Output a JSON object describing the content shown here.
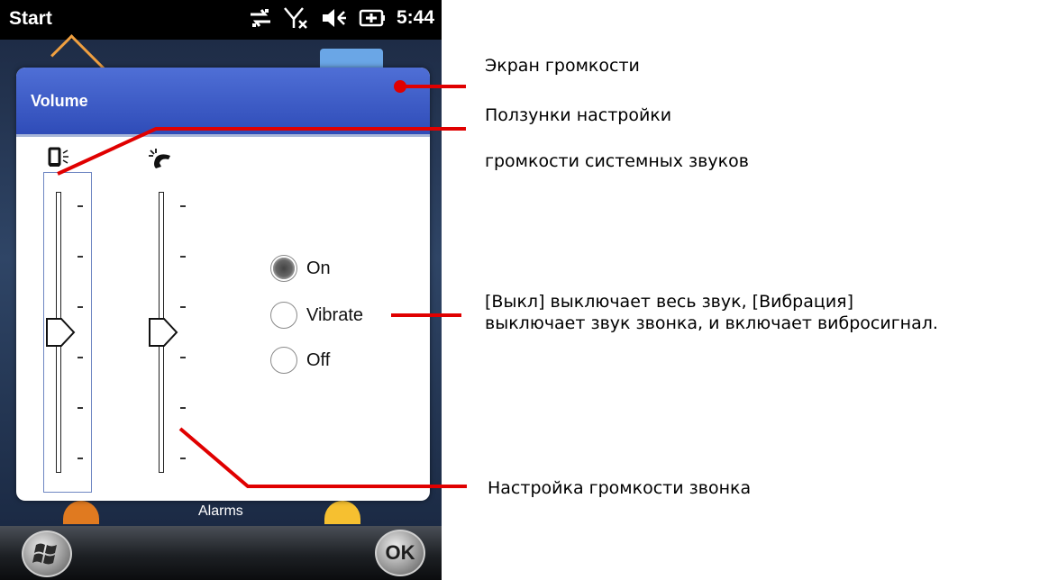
{
  "status_bar": {
    "start_label": "Start",
    "time": "5:44"
  },
  "home": {
    "alarms_label": "Alarms"
  },
  "dialog": {
    "title": "Volume",
    "device_volume_level": 0.5,
    "ringer_volume_level": 0.5,
    "ring_options": [
      {
        "label": "On",
        "selected": true
      },
      {
        "label": "Vibrate",
        "selected": false
      },
      {
        "label": "Off",
        "selected": false
      }
    ]
  },
  "softkeys": {
    "ok_label": "OK"
  },
  "annotations": {
    "volume_screen": "Экран громкости",
    "sliders_line1": "Ползунки настройки",
    "sliders_line2": "громкости системных звуков",
    "mode_line1": "[Выкл] выключает весь звук, [Вибрация]",
    "mode_line2": "выключает звук звонка, и включает вибросигнал.",
    "ring_volume": "Настройка громкости звонка"
  },
  "colors": {
    "callout_line": "#e00000",
    "dialog_header": "#3652c0"
  }
}
